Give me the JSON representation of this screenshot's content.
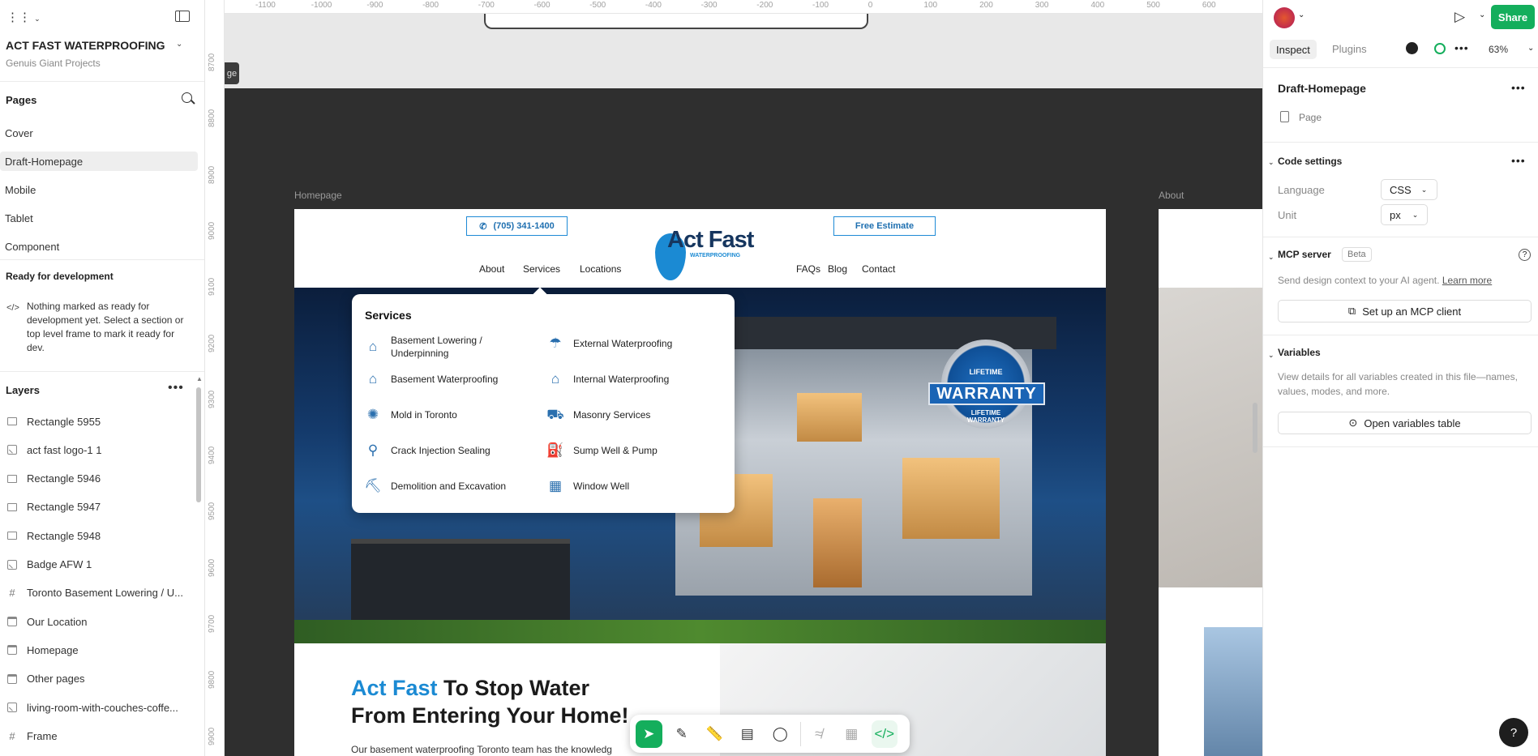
{
  "left_panel": {
    "project_name": "ACT FAST WATERPROOFING",
    "team": "Genuis Giant Projects",
    "pages_title": "Pages",
    "pages": [
      "Cover",
      "Draft-Homepage",
      "Mobile",
      "Tablet",
      "Component"
    ],
    "selected_page": "Draft-Homepage",
    "ready_title": "Ready for development",
    "ready_text": "Nothing marked as ready for development yet. Select a section or top level frame to mark it ready for dev.",
    "layers_title": "Layers",
    "layers": [
      {
        "name": "Rectangle 5955",
        "icon": "rectangle-icon"
      },
      {
        "name": "act fast logo-1 1",
        "icon": "image-icon"
      },
      {
        "name": "Rectangle 5946",
        "icon": "rectangle-icon"
      },
      {
        "name": "Rectangle 5947",
        "icon": "rectangle-icon"
      },
      {
        "name": "Rectangle 5948",
        "icon": "rectangle-icon"
      },
      {
        "name": "Badge AFW 1",
        "icon": "image-icon"
      },
      {
        "name": "Toronto Basement Lowering / U...",
        "icon": "frame-icon"
      },
      {
        "name": "Our Location",
        "icon": "section-icon"
      },
      {
        "name": "Homepage",
        "icon": "section-icon"
      },
      {
        "name": "Other pages",
        "icon": "section-icon"
      },
      {
        "name": "living-room-with-couches-coffe...",
        "icon": "image-icon"
      },
      {
        "name": "Frame",
        "icon": "frame-icon"
      }
    ]
  },
  "rulers": {
    "h": [
      "-1100",
      "-1000",
      "-900",
      "-800",
      "-700",
      "-600",
      "-500",
      "-400",
      "-300",
      "-200",
      "-100",
      "0",
      "100",
      "200",
      "300",
      "400",
      "500",
      "600"
    ],
    "v": [
      "8700",
      "8800",
      "8900",
      "9000",
      "9100",
      "9200",
      "9300",
      "9400",
      "9500",
      "9600",
      "9700",
      "9800",
      "9900"
    ]
  },
  "canvas": {
    "edge_tag": "ge",
    "homepage_label": "Homepage",
    "about_label": "About",
    "site": {
      "phone": "(705) 341-1400",
      "estimate": "Free Estimate",
      "logo_main": "Act Fast",
      "logo_sub": "WATERPROOFING",
      "nav_left": [
        "About",
        "Services",
        "Locations"
      ],
      "nav_right": [
        "FAQs",
        "Blog",
        "Contact"
      ],
      "dropdown_title": "Services",
      "services_left": [
        {
          "label": "Basement Lowering / Underpinning",
          "icon": "house-down-icon"
        },
        {
          "label": "Basement Waterproofing",
          "icon": "house-drop-icon"
        },
        {
          "label": "Mold in Toronto",
          "icon": "mold-icon"
        },
        {
          "label": "Crack Injection Sealing",
          "icon": "injector-icon"
        },
        {
          "label": "Demolition and Excavation",
          "icon": "excavator-icon"
        }
      ],
      "services_right": [
        {
          "label": "External Waterproofing",
          "icon": "rain-house-icon"
        },
        {
          "label": "Internal Waterproofing",
          "icon": "house-drop-icon"
        },
        {
          "label": "Masonry Services",
          "icon": "wheelbarrow-icon"
        },
        {
          "label": "Sump Well & Pump",
          "icon": "pump-icon"
        },
        {
          "label": "Window Well",
          "icon": "window-icon"
        }
      ],
      "badge_top": "LIFETIME",
      "badge_main": "WARRANTY",
      "badge_bottom": "LIFETIME WARRANTY",
      "badge_ring": "LIFETIME WARRANTY",
      "headline_accent": "Act Fast",
      "headline_rest": " To Stop Water",
      "headline_line2": "From Entering Your Home!",
      "body_text": "Our basement waterproofing Toronto team has the knowledg"
    }
  },
  "toolbar": {
    "tools": [
      "move-icon",
      "pen-icon",
      "ruler-icon",
      "annotate-icon",
      "comment-icon",
      "scribble-icon",
      "table-icon",
      "code-icon"
    ]
  },
  "right_panel": {
    "tab_inspect": "Inspect",
    "tab_plugins": "Plugins",
    "zoom": "63%",
    "share": "Share",
    "selection_name": "Draft-Homepage",
    "selection_type": "Page",
    "code_settings": "Code settings",
    "language_label": "Language",
    "language_value": "CSS",
    "unit_label": "Unit",
    "unit_value": "px",
    "mcp_title": "MCP server",
    "mcp_badge": "Beta",
    "mcp_desc": "Send design context to your AI agent.",
    "mcp_link": "Learn more",
    "mcp_button": "Set up an MCP client",
    "variables_title": "Variables",
    "variables_desc": "View details for all variables created in this file—names, values, modes, and more.",
    "variables_button": "Open variables table",
    "help": "?"
  }
}
